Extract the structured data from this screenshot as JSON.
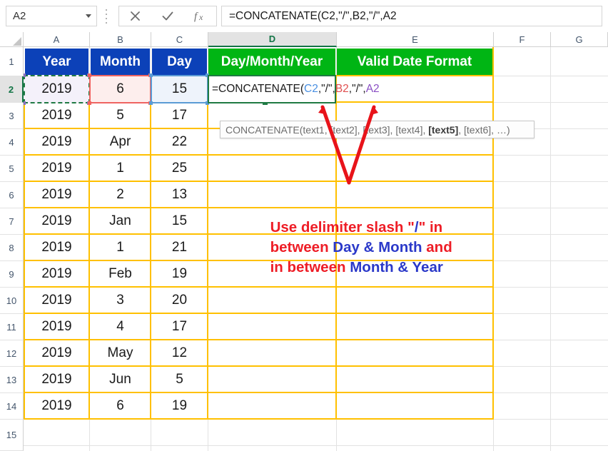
{
  "formula_bar": {
    "name_box_value": "A2",
    "name_box_dropdown_icon": "chevron-down-icon",
    "more_options_icon": "vertical-dots-icon",
    "cancel_icon": "cancel-x-icon",
    "enter_icon": "enter-check-icon",
    "function_icon": "fx-insert-function-icon",
    "formula_value": "=CONCATENATE(C2,\"/\",B2,\"/\",A2"
  },
  "grid": {
    "column_headers": [
      "A",
      "B",
      "C",
      "D",
      "E",
      "F",
      "G"
    ],
    "active_column": "D",
    "row_headers": [
      "1",
      "2",
      "3",
      "4",
      "5",
      "6",
      "7",
      "8",
      "9",
      "10",
      "11",
      "12",
      "13",
      "14",
      "15"
    ],
    "active_row": "2",
    "table_headers": [
      {
        "text": "Year",
        "color": "#0c41b8"
      },
      {
        "text": "Month",
        "color": "#0c41b8"
      },
      {
        "text": "Day",
        "color": "#0c41b8"
      },
      {
        "text": "Day/Month/Year",
        "color": "#00b514"
      },
      {
        "text": "Valid Date Format",
        "color": "#00b514"
      }
    ],
    "rows": [
      {
        "row": "2",
        "year": "2019",
        "month": "6",
        "day": "15",
        "dmy": "",
        "valid": ""
      },
      {
        "row": "3",
        "year": "2019",
        "month": "5",
        "day": "17",
        "dmy": "",
        "valid": ""
      },
      {
        "row": "4",
        "year": "2019",
        "month": "Apr",
        "day": "22",
        "dmy": "",
        "valid": ""
      },
      {
        "row": "5",
        "year": "2019",
        "month": "1",
        "day": "25",
        "dmy": "",
        "valid": ""
      },
      {
        "row": "6",
        "year": "2019",
        "month": "2",
        "day": "13",
        "dmy": "",
        "valid": ""
      },
      {
        "row": "7",
        "year": "2019",
        "month": "Jan",
        "day": "15",
        "dmy": "",
        "valid": ""
      },
      {
        "row": "8",
        "year": "2019",
        "month": "1",
        "day": "21",
        "dmy": "",
        "valid": ""
      },
      {
        "row": "9",
        "year": "2019",
        "month": "Feb",
        "day": "19",
        "dmy": "",
        "valid": ""
      },
      {
        "row": "10",
        "year": "2019",
        "month": "3",
        "day": "20",
        "dmy": "",
        "valid": ""
      },
      {
        "row": "11",
        "year": "2019",
        "month": "4",
        "day": "17",
        "dmy": "",
        "valid": ""
      },
      {
        "row": "12",
        "year": "2019",
        "month": "May",
        "day": "12",
        "dmy": "",
        "valid": ""
      },
      {
        "row": "13",
        "year": "2019",
        "month": "Jun",
        "day": "5",
        "dmy": "",
        "valid": ""
      },
      {
        "row": "14",
        "year": "2019",
        "month": "6",
        "day": "19",
        "dmy": "",
        "valid": ""
      }
    ]
  },
  "editing": {
    "cell": "D2",
    "text_plain": "=CONCATENATE(",
    "ref_c": "C2",
    "sep1": ",\"/\",",
    "ref_b": "B2",
    "sep2": ",\"/\",",
    "ref_a": "A2",
    "reference_colors": {
      "C2": "#4a90e2",
      "B2": "#e05050",
      "A2": "#8a4fc4"
    }
  },
  "tooltip": {
    "prefix": "CONCATENATE(text1, [text2], [text3], [text4], ",
    "bold_arg": "[text5]",
    "suffix": ", [text6], …)"
  },
  "annotation": {
    "line1_a": "Use delimiter slash \"",
    "line1_slash": "/",
    "line1_b": "\" in",
    "line2_a": "between ",
    "line2_blue": "Day & Month",
    "line2_b": " and",
    "line3_a": "in between ",
    "line3_blue": "Month & Year",
    "text_color": "#ee1d26",
    "highlight_color": "#2b39c9",
    "arrow_icon": "red-v-arrow-annotation"
  }
}
